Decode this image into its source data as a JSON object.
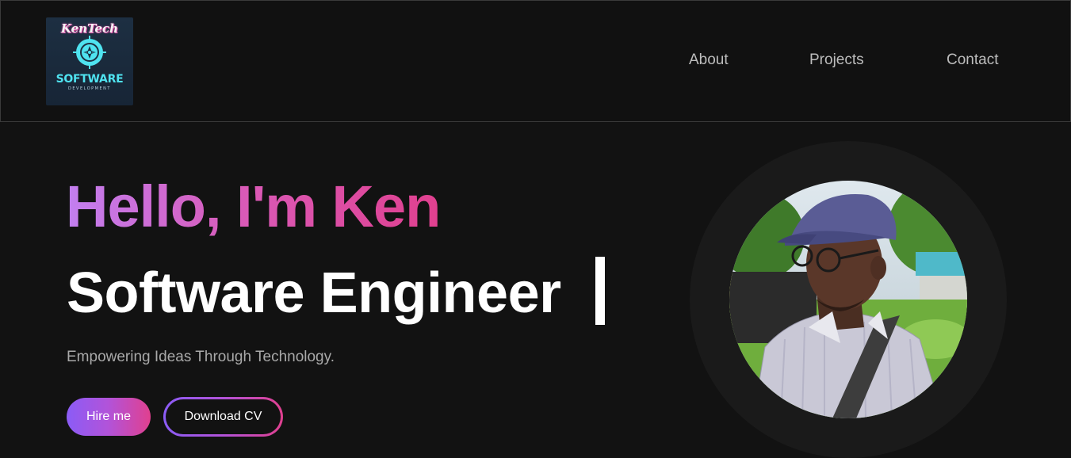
{
  "logo": {
    "script_text": "KenTech",
    "main_text": "SOFTWARE",
    "sub_text": "DEVELOPMENT",
    "emblem": "compass-icon"
  },
  "nav": {
    "items": [
      {
        "label": "About"
      },
      {
        "label": "Projects"
      },
      {
        "label": "Contact"
      }
    ]
  },
  "hero": {
    "greeting": "Hello, I'm Ken",
    "role": "Software Engineer",
    "tagline": "Empowering Ideas Through Technology.",
    "hire_label": "Hire me",
    "download_label": "Download CV"
  },
  "colors": {
    "background": "#121212",
    "navbar": "#111111",
    "gradient_start": "#8b5cf6",
    "gradient_end": "#e0408f",
    "greeting_start": "#c27ff0",
    "nav_text": "#bdbdbd",
    "tagline": "#a9a9a9",
    "logo_cyan": "#4fe3f0"
  },
  "portrait": {
    "icon": "profile-photo"
  }
}
